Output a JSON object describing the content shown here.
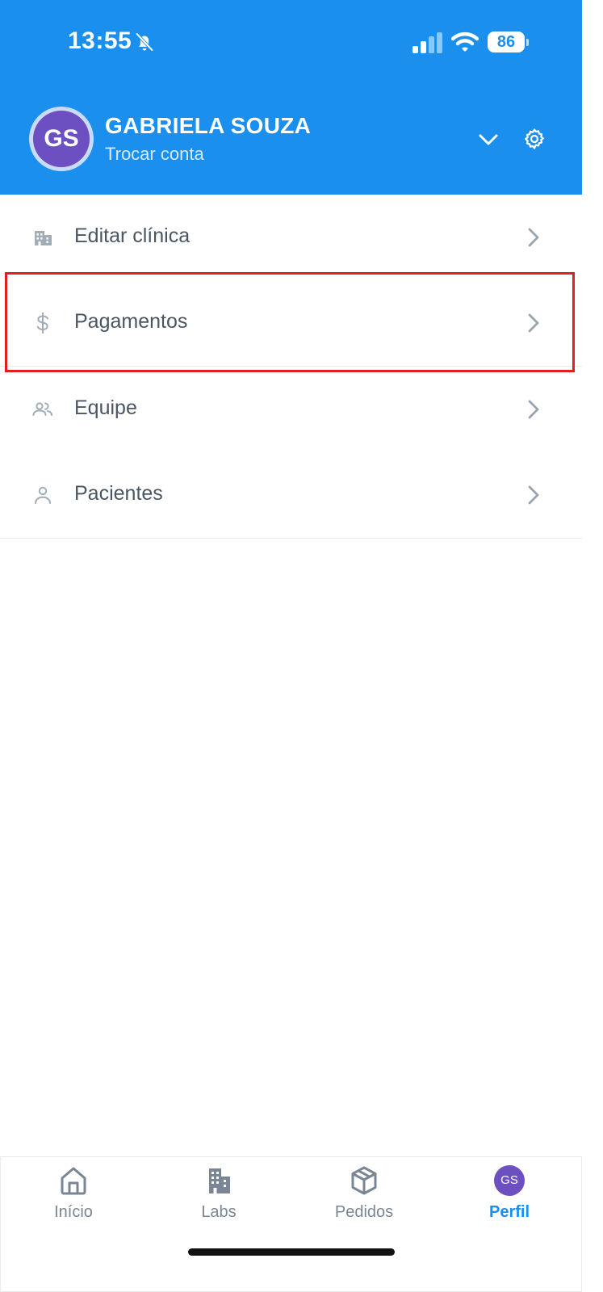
{
  "status_bar": {
    "time": "13:55",
    "battery": "86",
    "icons": [
      "bell-off-icon",
      "signal-icon",
      "wifi-icon",
      "battery-icon"
    ]
  },
  "header": {
    "avatar_initials": "GS",
    "name": "GABRIELA SOUZA",
    "subtitle": "Trocar conta",
    "icons": [
      "chevron-down-icon",
      "gear-icon"
    ],
    "background_color": "#1a8fee",
    "avatar_color": "#6c4fc0"
  },
  "menu": {
    "items": [
      {
        "label": "Editar clínica",
        "icon": "building-icon"
      },
      {
        "label": "Pagamentos",
        "icon": "dollar-icon"
      },
      {
        "label": "Equipe",
        "icon": "team-icon"
      },
      {
        "label": "Pacientes",
        "icon": "person-icon"
      }
    ],
    "highlighted_item": "Pagamentos",
    "highlight_color": "#e0201f"
  },
  "tabbar": {
    "tabs": [
      {
        "label": "Início",
        "icon": "home-icon",
        "active": false
      },
      {
        "label": "Labs",
        "icon": "buildings-icon",
        "active": false
      },
      {
        "label": "Pedidos",
        "icon": "package-icon",
        "active": false
      },
      {
        "label": "Perfil",
        "icon": "avatar",
        "active": true
      }
    ],
    "profile_initials": "GS",
    "active_color": "#1a8fee"
  }
}
